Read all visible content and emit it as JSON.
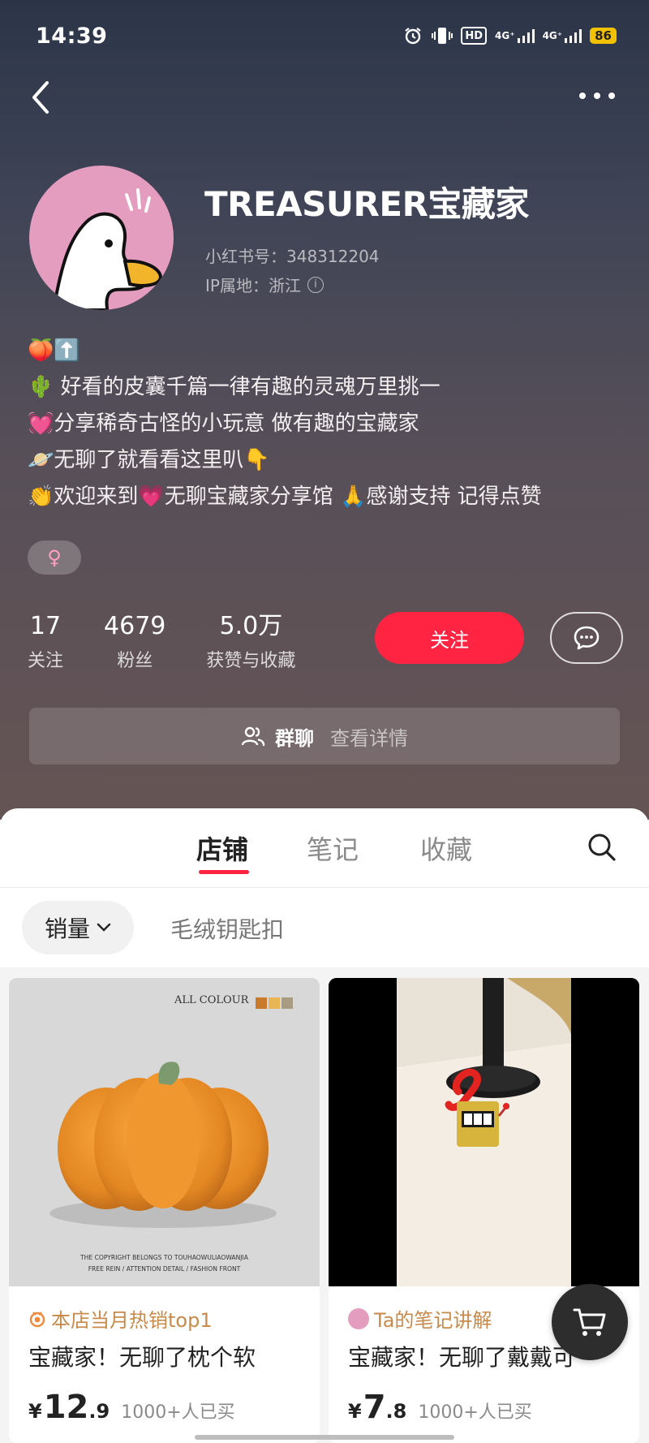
{
  "status_bar": {
    "time": "14:39",
    "icons": [
      "alarm-icon",
      "vibrate-icon",
      "hd-icon",
      "signal-4g-icon",
      "signal-4g-icon"
    ],
    "hd_label": "HD",
    "net1": "4G⁺",
    "net2": "4G⁺",
    "battery": "86"
  },
  "profile": {
    "name": "TREASURER宝藏家",
    "xhs_id": "小红书号：348312204",
    "ip_location": "IP属地：浙江",
    "bio": [
      "🍑⬆️",
      "🌵 好看的皮囊千篇一律有趣的灵魂万里挑一",
      "💓分享稀奇古怪的小玩意 做有趣的宝藏家",
      "🪐无聊了就看看这里叭👇",
      "👏欢迎来到💗无聊宝藏家分享馆 🙏感谢支持 记得点赞"
    ],
    "gender": "♀"
  },
  "stats": [
    {
      "value": "17",
      "label": "关注"
    },
    {
      "value": "4679",
      "label": "粉丝"
    },
    {
      "value": "5.0万",
      "label": "获赞与收藏"
    }
  ],
  "actions": {
    "follow": "关注",
    "message_icon": "chat-bubble-icon"
  },
  "group_chat": {
    "title": "群聊",
    "detail": "查看详情"
  },
  "tabs": [
    {
      "label": "店铺",
      "active": true
    },
    {
      "label": "笔记",
      "active": false
    },
    {
      "label": "收藏",
      "active": false
    }
  ],
  "filters": {
    "sort": "销量",
    "tag": "毛绒钥匙扣"
  },
  "products": [
    {
      "image_text": {
        "top": "ALL COLOUR",
        "bottom1": "THE COPYRIGHT BELONGS TO TOUHAOWULIAOWANJIA",
        "bottom2": "FREE REIN /   ATTENTION DETAIL /   FASHION FRONT"
      },
      "badge": "本店当月热销top1",
      "title": "宝藏家！无聊了枕个软",
      "currency": "¥",
      "price_int": "12",
      "price_dec": ".9",
      "sold": "1000+人已买"
    },
    {
      "badge": "Ta的笔记讲解",
      "title": "宝藏家！无聊了戴戴可",
      "currency": "¥",
      "price_int": "7",
      "price_dec": ".8",
      "sold": "1000+人已买"
    }
  ],
  "colors": {
    "accent": "#ff2442",
    "badge_text": "#c88a4a"
  }
}
